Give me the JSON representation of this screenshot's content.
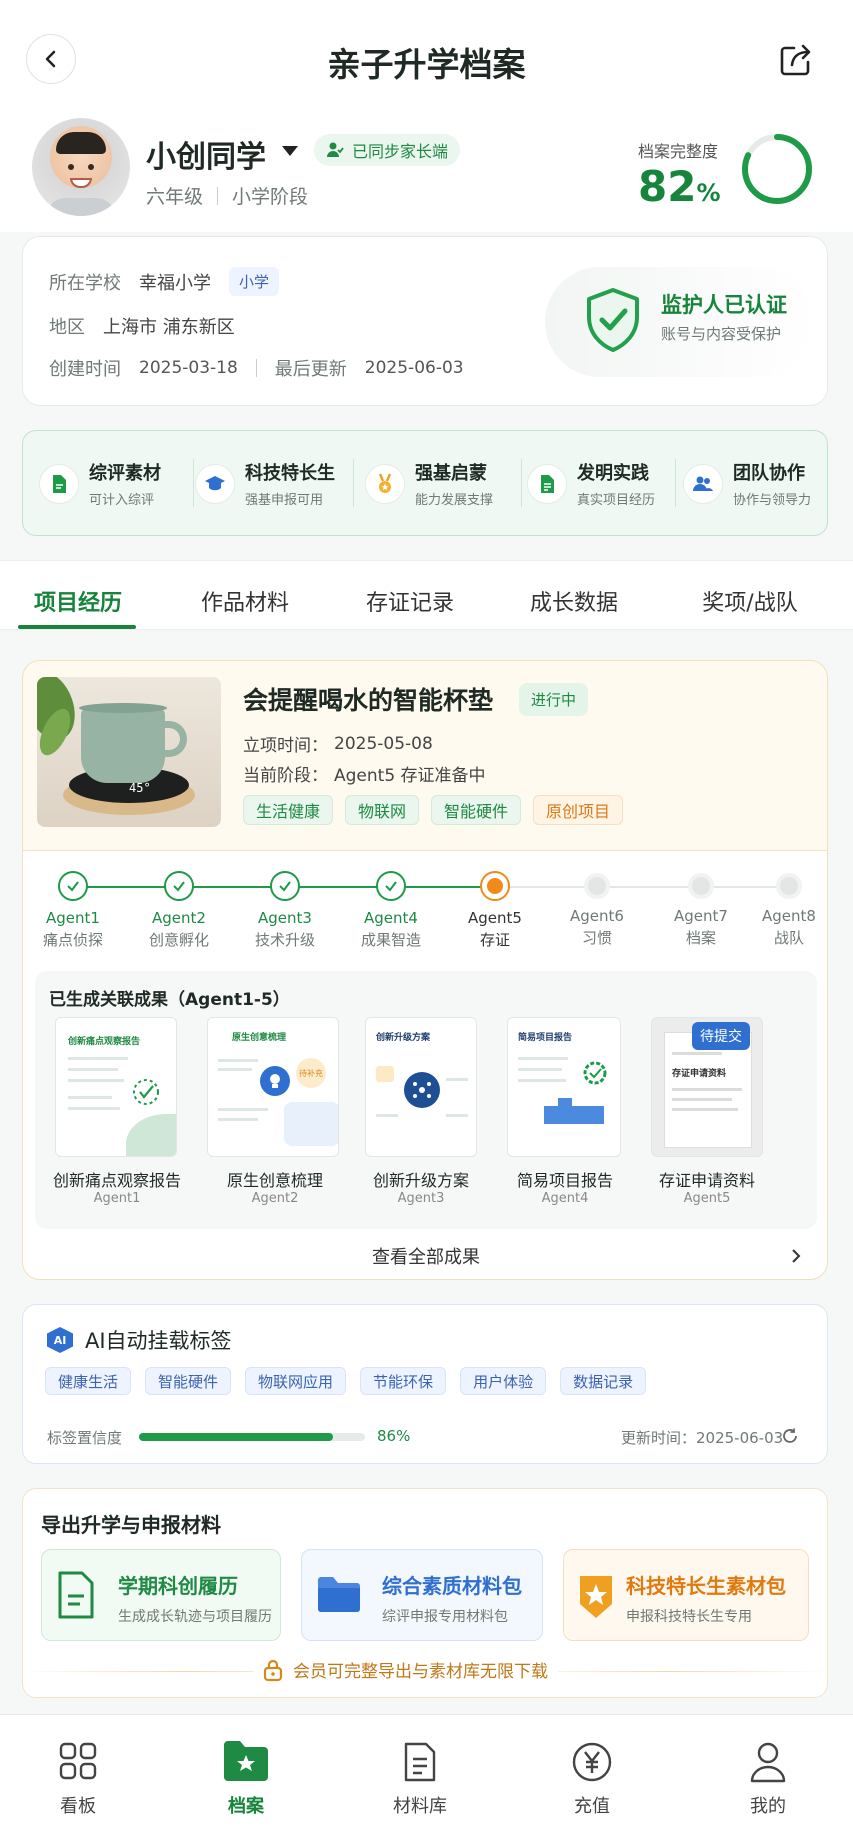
{
  "header": {
    "title": "亲子升学档案"
  },
  "profile": {
    "name": "小创同学",
    "sync_badge": "已同步家长端",
    "grade": "六年级",
    "stage": "小学阶段",
    "completeness_label": "档案完整度",
    "completeness_value": "82",
    "completeness_unit": "%",
    "completeness_fraction": 0.82
  },
  "info": {
    "school_label": "所在学校",
    "school": "幸福小学",
    "school_tag": "小学",
    "region_label": "地区",
    "region": "上海市 浦东新区",
    "created_label": "创建时间",
    "created": "2025-03-18",
    "updated_label": "最后更新",
    "updated": "2025-06-03",
    "guardian_title": "监护人已认证",
    "guardian_sub": "账号与内容受保护"
  },
  "quick": [
    {
      "title": "综评素材",
      "sub": "可计入综评",
      "icon": "document-icon"
    },
    {
      "title": "科技特长生",
      "sub": "强基申报可用",
      "icon": "graduation-cap-icon"
    },
    {
      "title": "强基启蒙",
      "sub": "能力发展支撑",
      "icon": "medal-icon"
    },
    {
      "title": "发明实践",
      "sub": "真实项目经历",
      "icon": "file-icon"
    },
    {
      "title": "团队协作",
      "sub": "协作与领导力",
      "icon": "team-icon"
    }
  ],
  "tabs": [
    "项目经历",
    "作品材料",
    "存证记录",
    "成长数据",
    "奖项/战队"
  ],
  "project": {
    "title": "会提醒喝水的智能杯垫",
    "status": "进行中",
    "start_label": "立项时间：",
    "start": "2025-05-08",
    "stage_label": "当前阶段：",
    "stage": "Agent5 存证准备中",
    "tags": [
      "生活健康",
      "物联网",
      "智能硬件",
      "原创项目"
    ],
    "coaster_reading": "45°"
  },
  "steps": [
    {
      "agent": "Agent1",
      "label": "痛点侦探",
      "state": "done"
    },
    {
      "agent": "Agent2",
      "label": "创意孵化",
      "state": "done"
    },
    {
      "agent": "Agent3",
      "label": "技术升级",
      "state": "done"
    },
    {
      "agent": "Agent4",
      "label": "成果智造",
      "state": "done"
    },
    {
      "agent": "Agent5",
      "label": "存证",
      "state": "current"
    },
    {
      "agent": "Agent6",
      "label": "习惯",
      "state": "pending"
    },
    {
      "agent": "Agent7",
      "label": "档案",
      "state": "pending"
    },
    {
      "agent": "Agent8",
      "label": "战队",
      "state": "pending"
    }
  ],
  "results": {
    "title": "已生成关联成果（Agent1-5）",
    "items": [
      {
        "name": "创新痛点观察报告",
        "agent": "Agent1",
        "thumb_title": "创新痛点观察报告"
      },
      {
        "name": "原生创意梳理",
        "agent": "Agent2",
        "thumb_title": "原生创意梳理",
        "thumb_chip": "待补充"
      },
      {
        "name": "创新升级方案",
        "agent": "Agent3",
        "thumb_title": "创新升级方案"
      },
      {
        "name": "简易项目报告",
        "agent": "Agent4",
        "thumb_title": "简易项目报告"
      },
      {
        "name": "存证申请资料",
        "agent": "Agent5",
        "thumb_title": "存证申请资料",
        "badge": "待提交"
      }
    ],
    "view_all": "查看全部成果"
  },
  "ai_tags": {
    "icon_text": "AI",
    "title": "AI自动挂载标签",
    "tags": [
      "健康生活",
      "智能硬件",
      "物联网应用",
      "节能环保",
      "用户体验",
      "数据记录"
    ],
    "confidence_label": "标签置信度",
    "confidence_value": "86%",
    "confidence_fraction": 0.86,
    "updated": "更新时间：2025-06-03"
  },
  "export": {
    "title": "导出升学与申报材料",
    "cards": [
      {
        "title": "学期科创履历",
        "sub": "生成成长轨迹与项目履历",
        "color": "#1e8a43"
      },
      {
        "title": "综合素质材料包",
        "sub": "综评申报专用材料包",
        "color": "#2f6fd0"
      },
      {
        "title": "科技特长生素材包",
        "sub": "申报科技特长生专用",
        "color": "#e07a10"
      }
    ],
    "member_note": "会员可完整导出与素材库无限下载"
  },
  "nav": [
    {
      "label": "看板",
      "icon": "grid-icon",
      "active": false
    },
    {
      "label": "档案",
      "icon": "folder-star-icon",
      "active": true
    },
    {
      "label": "材料库",
      "icon": "document-list-icon",
      "active": false
    },
    {
      "label": "充值",
      "icon": "yuan-coin-icon",
      "active": false
    },
    {
      "label": "我的",
      "icon": "user-icon",
      "active": false
    }
  ],
  "colors": {
    "accent": "#16843a",
    "orange": "#f08a18",
    "blue": "#2f6fd0"
  }
}
